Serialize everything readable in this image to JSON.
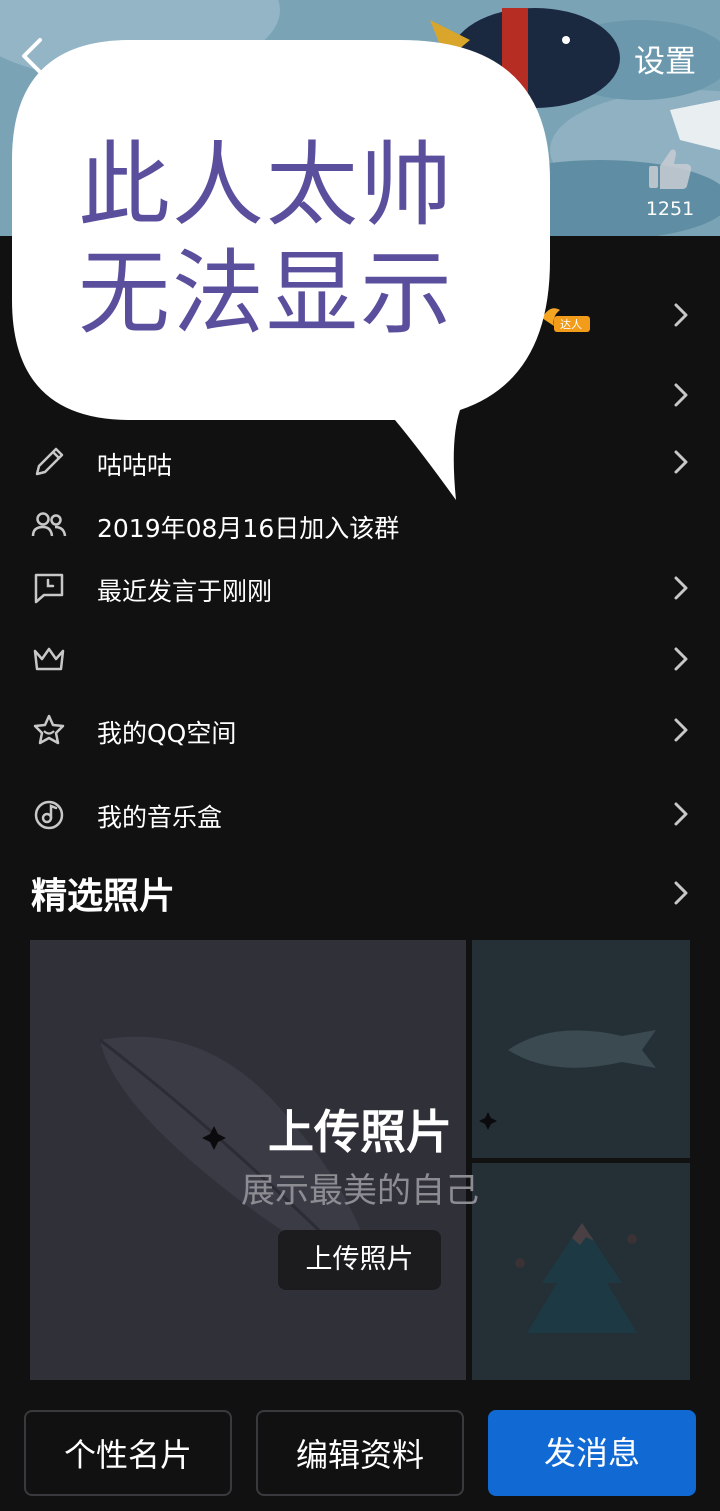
{
  "header": {
    "settings_label": "设置",
    "like_count": "1251"
  },
  "overlay": {
    "line1": "此人太帅",
    "line2": "无法显示"
  },
  "badge": {
    "label": "达人"
  },
  "rows": [
    {
      "icon": "pencil-icon",
      "label": "咕咕咕"
    },
    {
      "icon": "members-icon",
      "label": "2019年08月16日加入该群"
    },
    {
      "icon": "chat-clock-icon",
      "label": "最近发言于刚刚"
    },
    {
      "icon": "crown-icon",
      "label": ""
    },
    {
      "icon": "star-icon",
      "label": "我的QQ空间"
    },
    {
      "icon": "music-icon",
      "label": "我的音乐盒"
    }
  ],
  "photos": {
    "section_title": "精选照片",
    "upload_title": "上传照片",
    "upload_subtitle": "展示最美的自己",
    "upload_button": "上传照片"
  },
  "bottom_bar": {
    "card_label": "个性名片",
    "edit_label": "编辑资料",
    "message_label": "发消息"
  },
  "colors": {
    "accent": "#1169d4",
    "background": "#111111",
    "overlay_text": "#5a4f9c"
  }
}
